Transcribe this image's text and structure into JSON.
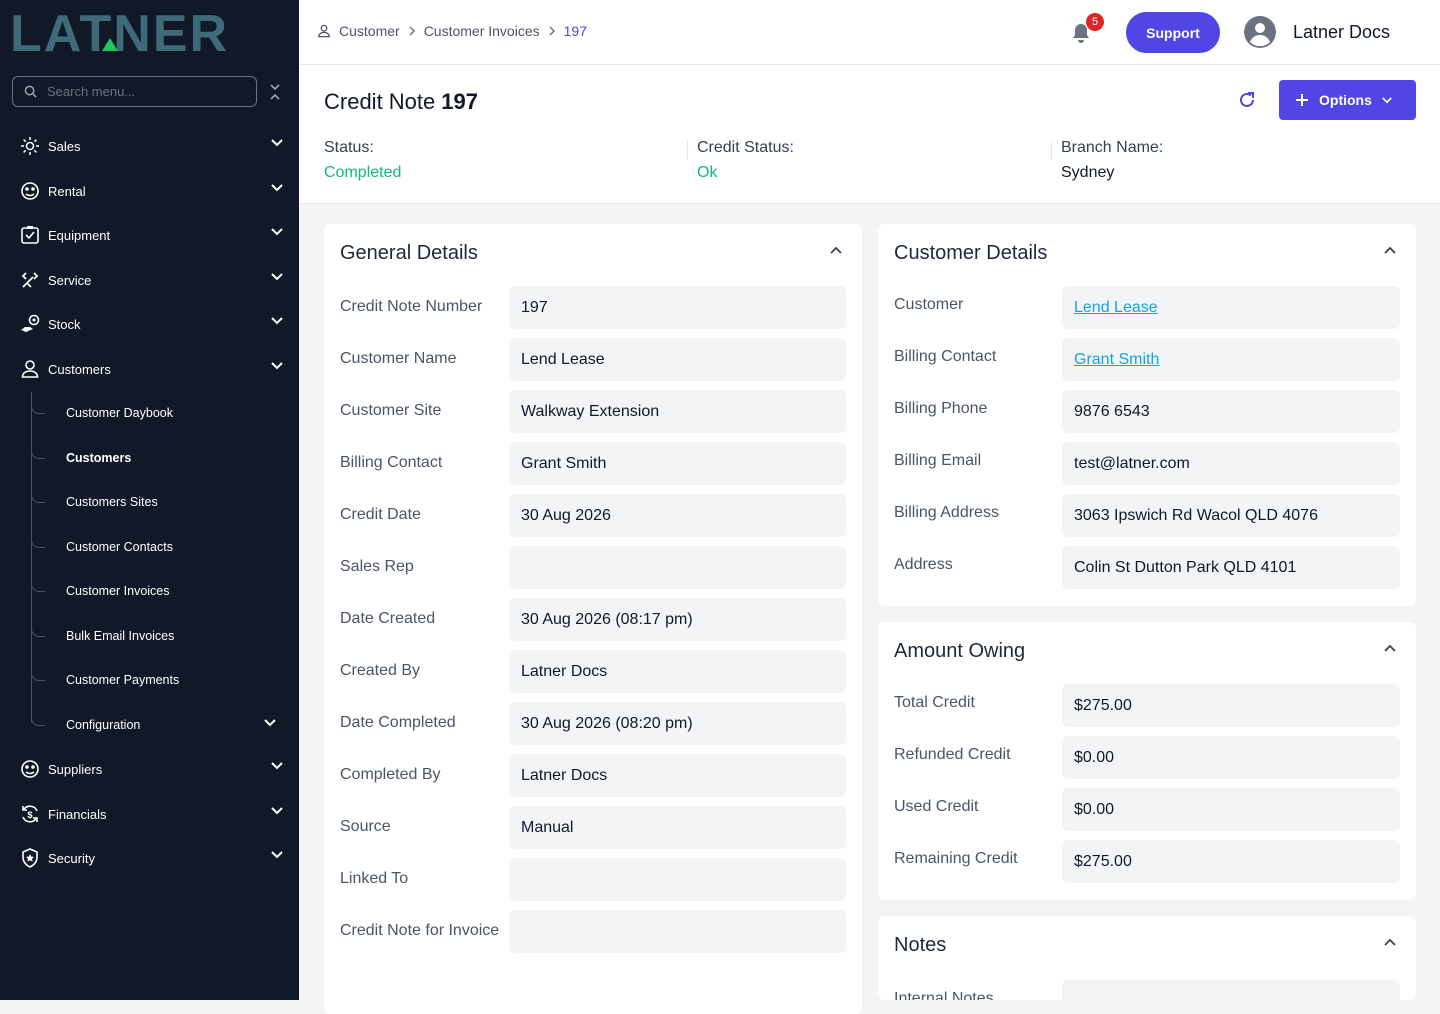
{
  "brand": {
    "logo_text": "LATNER"
  },
  "sidebar": {
    "search_placeholder": "Search menu...",
    "items": [
      {
        "label": "Sales",
        "icon": "sales-icon"
      },
      {
        "label": "Rental",
        "icon": "rental-icon"
      },
      {
        "label": "Equipment",
        "icon": "equipment-icon"
      },
      {
        "label": "Service",
        "icon": "service-icon"
      },
      {
        "label": "Stock",
        "icon": "stock-icon"
      },
      {
        "label": "Customers",
        "icon": "user-icon"
      },
      {
        "label": "Suppliers",
        "icon": "suppliers-icon"
      },
      {
        "label": "Financials",
        "icon": "financials-icon"
      },
      {
        "label": "Security",
        "icon": "shield-icon"
      }
    ],
    "sub_items": [
      "Customer Daybook",
      "Customers",
      "Customers Sites",
      "Customer Contacts",
      "Customer Invoices",
      "Bulk Email Invoices",
      "Customer Payments",
      "Configuration"
    ]
  },
  "topbar": {
    "breadcrumbs": [
      "Customer",
      "Customer Invoices",
      "197"
    ],
    "notification_count": "5",
    "support_label": "Support",
    "user_name": "Latner Docs"
  },
  "header": {
    "title": "Credit Note",
    "number": "197",
    "options_label": "Options",
    "status_label": "Status:",
    "status_value": "Completed",
    "credit_status_label": "Credit Status:",
    "credit_status_value": "Ok",
    "branch_label": "Branch Name:",
    "branch_value": "Sydney",
    "status_color": "#10b981"
  },
  "general": {
    "title": "General Details",
    "rows": [
      {
        "label": "Credit Note Number",
        "value": "197"
      },
      {
        "label": "Customer Name",
        "value": "Lend Lease"
      },
      {
        "label": "Customer Site",
        "value": "Walkway Extension"
      },
      {
        "label": "Billing Contact",
        "value": "Grant Smith"
      },
      {
        "label": "Credit Date",
        "value": "30 Aug 2026"
      },
      {
        "label": "Sales Rep",
        "value": ""
      },
      {
        "label": "Date Created",
        "value": "30 Aug 2026 (08:17 pm)"
      },
      {
        "label": "Created By",
        "value": "Latner Docs"
      },
      {
        "label": "Date Completed",
        "value": "30 Aug 2026 (08:20 pm)"
      },
      {
        "label": "Completed By",
        "value": "Latner Docs"
      },
      {
        "label": "Source",
        "value": "Manual"
      },
      {
        "label": "Linked To",
        "value": ""
      },
      {
        "label": "Credit Note for Invoice",
        "value": ""
      }
    ]
  },
  "customer": {
    "title": "Customer Details",
    "rows": [
      {
        "label": "Customer",
        "value": "Lend Lease"
      },
      {
        "label": "Billing Contact",
        "value": "Grant Smith"
      },
      {
        "label": "Billing Phone",
        "value": "9876 6543"
      },
      {
        "label": "Billing Email",
        "value": "test@latner.com"
      },
      {
        "label": "Billing Address",
        "value": "3063 Ipswich Rd Wacol QLD 4076"
      },
      {
        "label": "Address",
        "value": "Colin St Dutton Park QLD 4101"
      }
    ]
  },
  "owing": {
    "title": "Amount Owing",
    "rows": [
      {
        "label": "Total Credit",
        "value": "$275.00"
      },
      {
        "label": "Refunded Credit",
        "value": "$0.00"
      },
      {
        "label": "Used Credit",
        "value": "$0.00"
      },
      {
        "label": "Remaining Credit",
        "value": "$275.00"
      }
    ]
  },
  "notes": {
    "title": "Notes",
    "first_label": "Internal Notes"
  },
  "colors": {
    "sidebar": "#111827",
    "accent": "#4f46e5",
    "link": "#0ea5e9",
    "status": "#10b981"
  }
}
